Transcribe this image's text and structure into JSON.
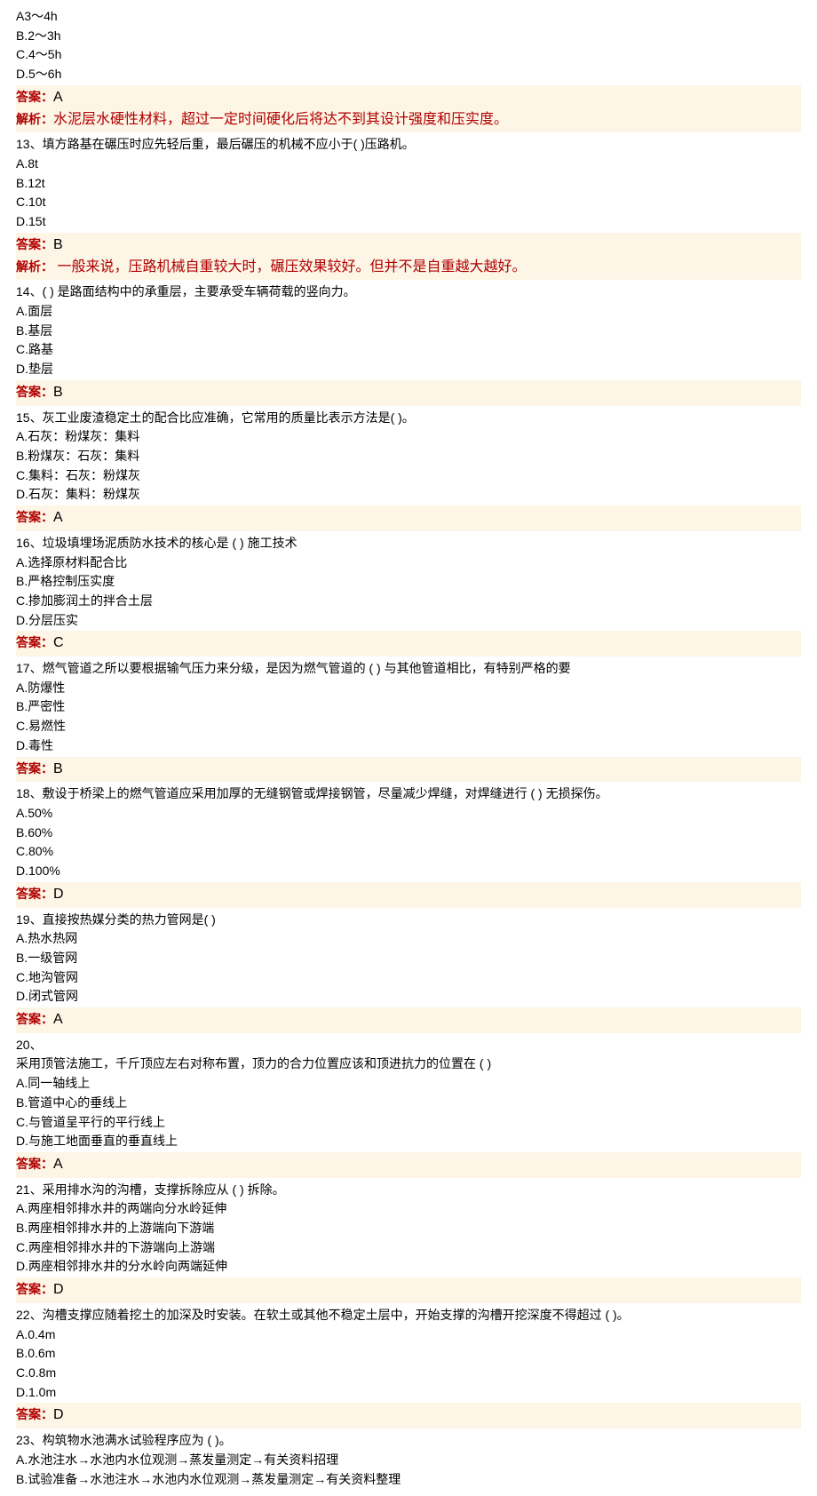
{
  "q12": {
    "optA": "A3～4h",
    "optB": "B.2～3h",
    "optC": "C.4～5h",
    "optD": "D.5～6h",
    "ans": "A",
    "explain": "水泥层水硬性材料，超过一定时间硬化后将达不到其设计强度和压实度。"
  },
  "q13": {
    "stem": "13、填方路基在碾压时应先轻后重，最后碾压的机械不应小于( )压路机。",
    "optA": "A.8t",
    "optB": "B.12t",
    "optC": "C.10t",
    "optD": "D.15t",
    "ans": "B",
    "explain": " 一般来说，压路机械自重较大时，碾压效果较好。但并不是自重越大越好。"
  },
  "q14": {
    "stem": "14、(  ) 是路面结构中的承重层，主要承受车辆荷载的竖向力。",
    "optA": "A.面层",
    "optB": "B.基层",
    "optC": "C.路基",
    "optD": "D.垫层",
    "ans": "B"
  },
  "q15": {
    "stem": "15、灰工业废渣稳定土的配合比应准确，它常用的质量比表示方法是(  )。",
    "optA": "A.石灰：粉煤灰：集料",
    "optB": "B.粉煤灰：石灰：集料",
    "optC": "C.集料：石灰：粉煤灰",
    "optD": "D.石灰：集料：粉煤灰",
    "ans": "A"
  },
  "q16": {
    "stem": "16、垃圾填埋场泥质防水技术的核心是 (  ) 施工技术",
    "optA": "A.选择原材料配合比",
    "optB": "B.严格控制压实度",
    "optC": "C.掺加膨润土的拌合土层",
    "optD": "D.分层压实",
    "ans": "C"
  },
  "q17": {
    "stem": "17、燃气管道之所以要根据输气压力来分级，是因为燃气管道的 (  ) 与其他管道相比，有特别严格的要",
    "optA": "A.防爆性",
    "optB": "B.严密性",
    "optC": "C.易燃性",
    "optD": "D.毒性",
    "ans": "B"
  },
  "q18": {
    "stem": "18、敷设于桥梁上的燃气管道应采用加厚的无缝钢管或焊接钢管，尽量减少焊缝，对焊缝进行 (  ) 无损探伤。",
    "optA": "A.50%",
    "optB": "B.60%",
    "optC": "C.80%",
    "optD": "D.100%",
    "ans": "D"
  },
  "q19": {
    "stem": "19、直接按热媒分类的热力管网是( )",
    "optA": "A.热水热网",
    "optB": "B.一级管网",
    "optC": "C.地沟管网",
    "optD": "D.闭式管网",
    "ans": "A"
  },
  "q20": {
    "num": "20、",
    "stem": "采用顶管法施工，千斤顶应左右对称布置，顶力的合力位置应该和顶进抗力的位置在 (  )",
    "optA": "A.同一轴线上",
    "optB": "B.管道中心的垂线上",
    "optC": "C.与管道呈平行的平行线上",
    "optD": "D.与施工地面垂直的垂直线上",
    "ans": "A"
  },
  "q21": {
    "stem": "21、采用排水沟的沟槽，支撑拆除应从 (  ) 拆除。",
    "optA": "A.两座相邻排水井的两端向分水岭延伸",
    "optB": "B.两座相邻排水井的上游端向下游端",
    "optC": "C.两座相邻排水井的下游端向上游端",
    "optD": "D.两座相邻排水井的分水岭向两端延伸",
    "ans": "D"
  },
  "q22": {
    "stem": "22、沟槽支撑应随着挖土的加深及时安装。在软土或其他不稳定土层中，开始支撑的沟槽开挖深度不得超过 (  )。",
    "optA": "A.0.4m",
    "optB": "B.0.6m",
    "optC": "C.0.8m",
    "optD": "D.1.0m",
    "ans": "D"
  },
  "q23": {
    "stem": "23、构筑物水池满水试验程序应为 (   )。",
    "optA": "A.水池注水→水池内水位观测→蒸发量测定→有关资料招理",
    "optB": "B.试验准备→水池注水→水池内水位观测→蒸发量测定→有关资料整理"
  },
  "labels": {
    "answer": "答案：",
    "explain": "解析："
  }
}
